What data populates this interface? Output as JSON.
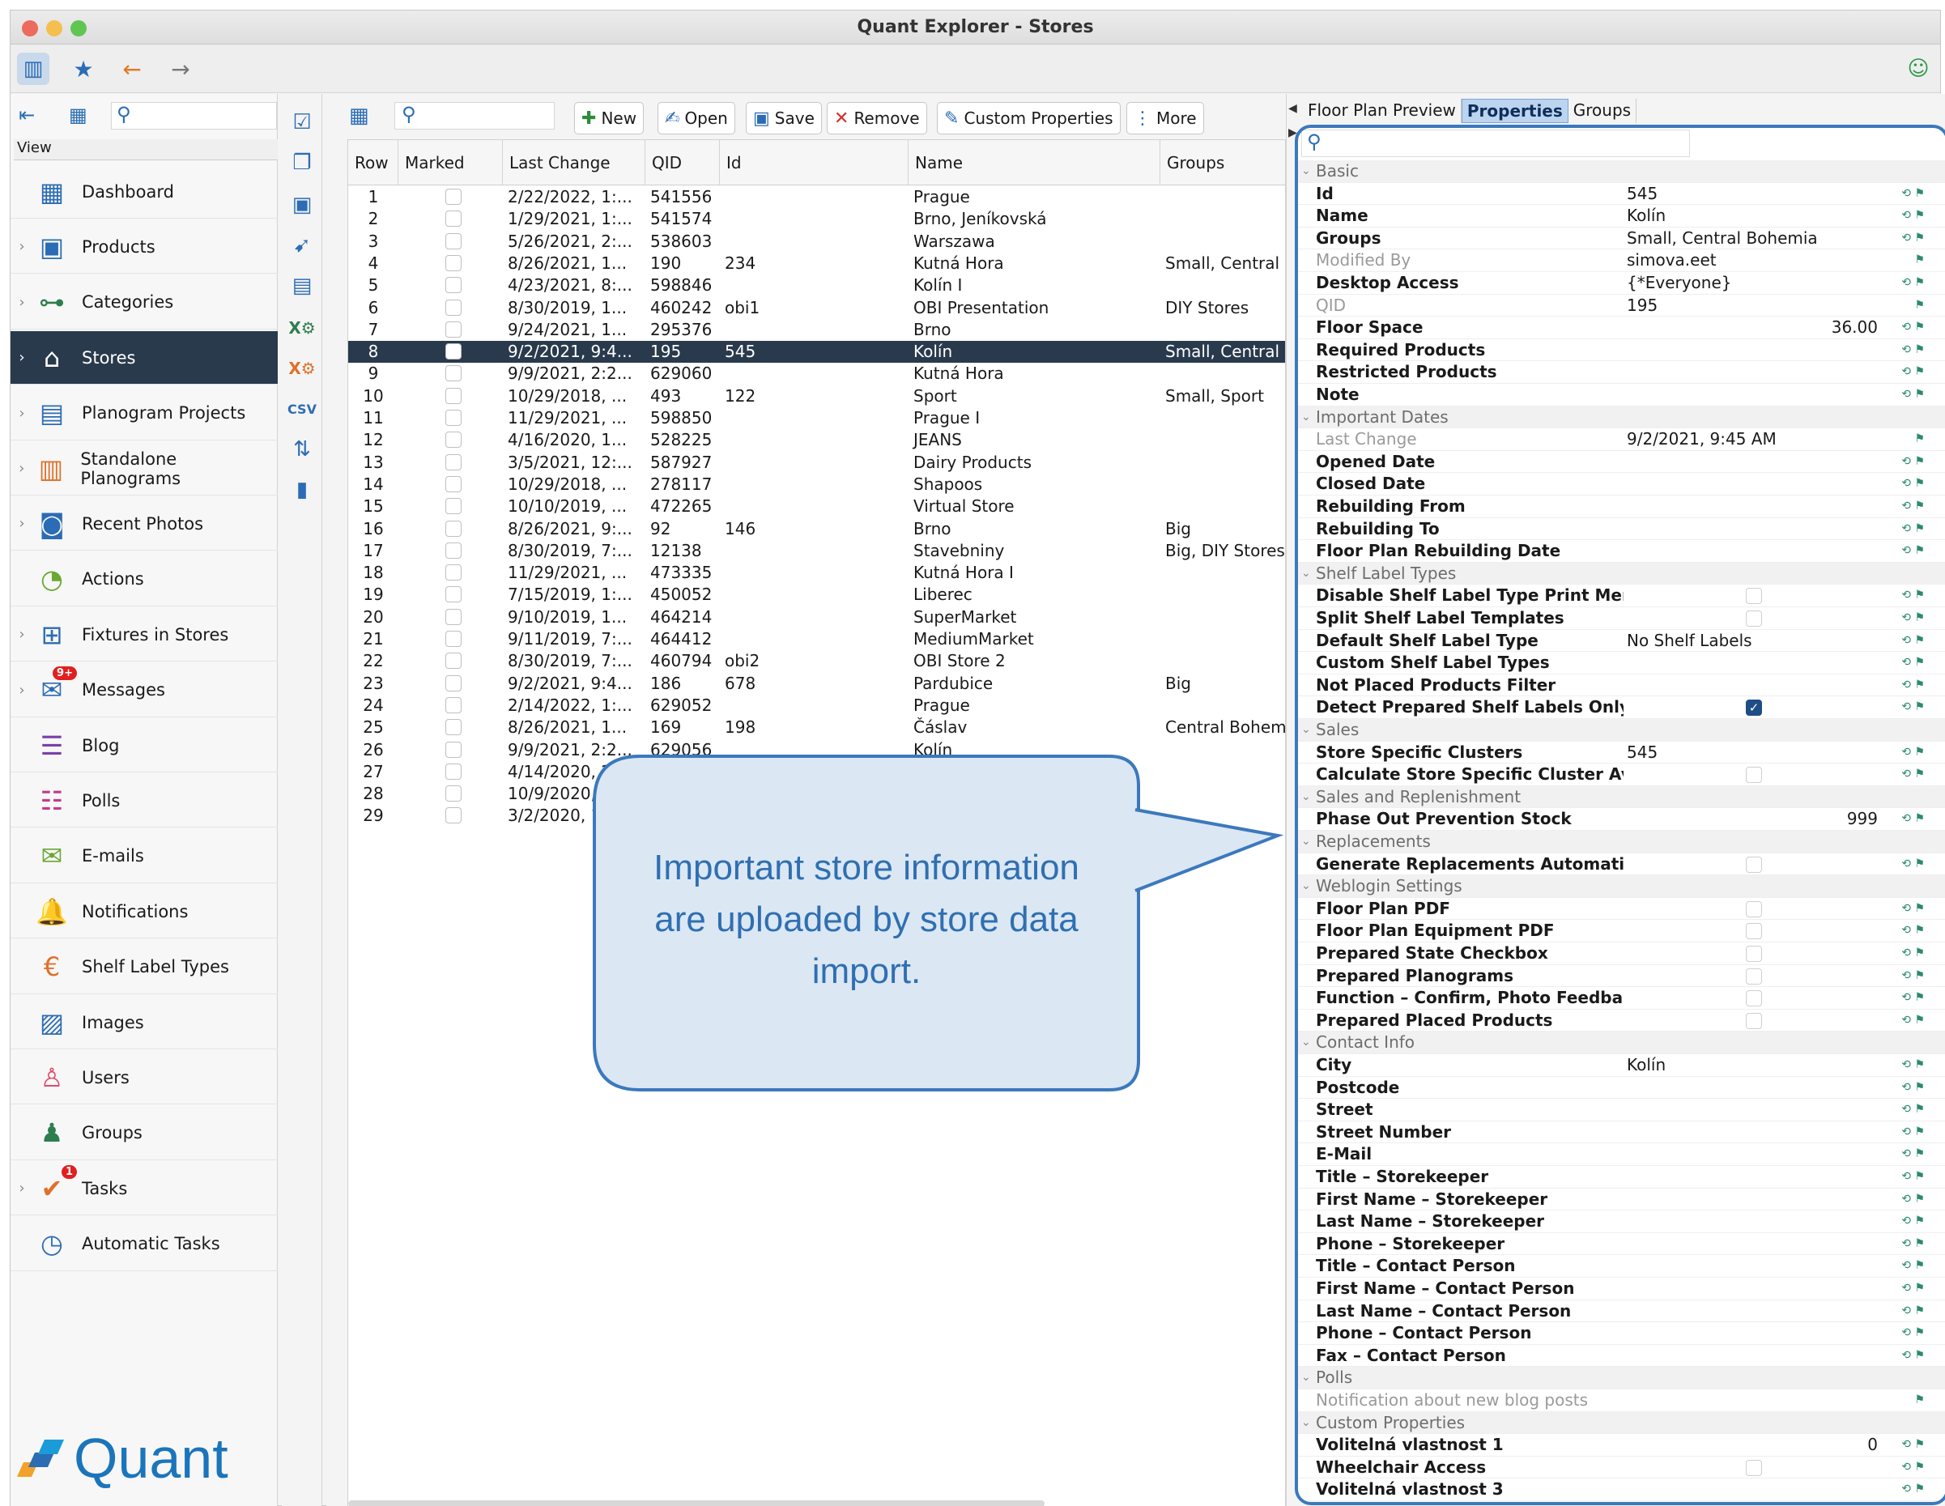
{
  "window": {
    "title": "Quant Explorer - Stores"
  },
  "nav_icons": {
    "sidebar_toggle": "sidebar-icon",
    "favorites": "star-icon",
    "back": "arrow-left-icon",
    "forward": "arrow-right-icon",
    "feedback": "smiley-icon"
  },
  "left_panel": {
    "view_label": "View",
    "items": [
      {
        "label": "Dashboard",
        "icon": "dashboard-icon",
        "glyph": "▦",
        "color": "#2b6cb4",
        "chevron": false
      },
      {
        "label": "Products",
        "icon": "products-icon",
        "glyph": "▣",
        "color": "#2b6cb4",
        "chevron": true
      },
      {
        "label": "Categories",
        "icon": "categories-icon",
        "glyph": "⊶",
        "color": "#2e7d4f",
        "chevron": true
      },
      {
        "label": "Stores",
        "icon": "store-icon",
        "glyph": "⌂",
        "color": "#e24a6a",
        "chevron": true,
        "selected": true
      },
      {
        "label": "Planogram Projects",
        "icon": "planogram-projects-icon",
        "glyph": "▤",
        "color": "#2b6cb4",
        "chevron": true
      },
      {
        "label": "Standalone Planograms",
        "icon": "standalone-planograms-icon",
        "glyph": "▥",
        "color": "#e0702a",
        "chevron": true
      },
      {
        "label": "Recent Photos",
        "icon": "camera-icon",
        "glyph": "◙",
        "color": "#2b6cb4",
        "chevron": true
      },
      {
        "label": "Actions",
        "icon": "actions-icon",
        "glyph": "◔",
        "color": "#6aa832",
        "chevron": false
      },
      {
        "label": "Fixtures in Stores",
        "icon": "fixtures-icon",
        "glyph": "⊞",
        "color": "#2b6cb4",
        "chevron": true
      },
      {
        "label": "Messages",
        "icon": "messages-icon",
        "glyph": "✉",
        "color": "#2b6cb4",
        "chevron": true,
        "badge": "9+"
      },
      {
        "label": "Blog",
        "icon": "blog-icon",
        "glyph": "☰",
        "color": "#7a3fa8",
        "chevron": false
      },
      {
        "label": "Polls",
        "icon": "polls-icon",
        "glyph": "☷",
        "color": "#c23a8a",
        "chevron": false
      },
      {
        "label": "E-mails",
        "icon": "email-icon",
        "glyph": "✉",
        "color": "#6aa832",
        "chevron": false
      },
      {
        "label": "Notifications",
        "icon": "notifications-icon",
        "glyph": "🔔",
        "color": "#2b6cb4",
        "chevron": false
      },
      {
        "label": "Shelf Label Types",
        "icon": "shelf-label-icon",
        "glyph": "€",
        "color": "#e0702a",
        "chevron": false
      },
      {
        "label": "Images",
        "icon": "images-icon",
        "glyph": "▨",
        "color": "#2b6cb4",
        "chevron": false
      },
      {
        "label": "Users",
        "icon": "users-icon",
        "glyph": "♙",
        "color": "#e24a6a",
        "chevron": false
      },
      {
        "label": "Groups",
        "icon": "groups-icon",
        "glyph": "♟",
        "color": "#2e7d4f",
        "chevron": false
      },
      {
        "label": "Tasks",
        "icon": "tasks-icon",
        "glyph": "✔",
        "color": "#e0702a",
        "chevron": true,
        "badge": "1"
      },
      {
        "label": "Automatic Tasks",
        "icon": "automatic-tasks-icon",
        "glyph": "◷",
        "color": "#2b6cb4",
        "chevron": false
      }
    ],
    "logo_text": "Quant"
  },
  "toolbar": {
    "new_label": "New",
    "open_label": "Open",
    "save_label": "Save",
    "remove_label": "Remove",
    "custom_label": "Custom Properties",
    "more_label": "More"
  },
  "table": {
    "columns": {
      "row": "Row",
      "marked": "Marked",
      "last_change": "Last Change",
      "qid": "QID",
      "id": "Id",
      "name": "Name",
      "groups": "Groups"
    },
    "rows": [
      {
        "row": "1",
        "last_change": "2/22/2022, 1:...",
        "qid": "541556",
        "id": "",
        "name": "Prague",
        "groups": ""
      },
      {
        "row": "2",
        "last_change": "1/29/2021, 1:...",
        "qid": "541574",
        "id": "",
        "name": "Brno, Jeníkovská",
        "groups": ""
      },
      {
        "row": "3",
        "last_change": "5/26/2021, 2:...",
        "qid": "538603",
        "id": "",
        "name": "Warszawa",
        "groups": ""
      },
      {
        "row": "4",
        "last_change": "8/26/2021, 1...",
        "qid": "190",
        "id": "234",
        "name": "Kutná Hora",
        "groups": "Small, Central"
      },
      {
        "row": "5",
        "last_change": "4/23/2021, 8:...",
        "qid": "598846",
        "id": "",
        "name": "Kolín I",
        "groups": ""
      },
      {
        "row": "6",
        "last_change": "8/30/2019, 1...",
        "qid": "460242",
        "id": "obi1",
        "name": "OBI Presentation",
        "groups": "DIY Stores"
      },
      {
        "row": "7",
        "last_change": "9/24/2021, 1...",
        "qid": "295376",
        "id": "",
        "name": "Brno",
        "groups": ""
      },
      {
        "row": "8",
        "last_change": "9/2/2021, 9:4...",
        "qid": "195",
        "id": "545",
        "name": "Kolín",
        "groups": "Small, Central",
        "selected": true
      },
      {
        "row": "9",
        "last_change": "9/9/2021, 2:2...",
        "qid": "629060",
        "id": "",
        "name": "Kutná Hora",
        "groups": ""
      },
      {
        "row": "10",
        "last_change": "10/29/2018, ...",
        "qid": "493",
        "id": "122",
        "name": "Sport",
        "groups": "Small, Sport"
      },
      {
        "row": "11",
        "last_change": "11/29/2021, ...",
        "qid": "598850",
        "id": "",
        "name": "Prague I",
        "groups": ""
      },
      {
        "row": "12",
        "last_change": "4/16/2020, 1...",
        "qid": "528225",
        "id": "",
        "name": "JEANS",
        "groups": ""
      },
      {
        "row": "13",
        "last_change": "3/5/2021, 12:...",
        "qid": "587927",
        "id": "",
        "name": "Dairy Products",
        "groups": ""
      },
      {
        "row": "14",
        "last_change": "10/29/2018, ...",
        "qid": "278117",
        "id": "",
        "name": "Shapoos",
        "groups": ""
      },
      {
        "row": "15",
        "last_change": "10/10/2019, ...",
        "qid": "472265",
        "id": "",
        "name": "Virtual Store",
        "groups": ""
      },
      {
        "row": "16",
        "last_change": "8/26/2021, 9:...",
        "qid": "92",
        "id": "146",
        "name": "Brno",
        "groups": "Big"
      },
      {
        "row": "17",
        "last_change": "8/30/2019, 7:...",
        "qid": "12138",
        "id": "",
        "name": "Stavebniny",
        "groups": "Big, DIY Stores"
      },
      {
        "row": "18",
        "last_change": "11/29/2021, ...",
        "qid": "473335",
        "id": "",
        "name": "Kutná Hora I",
        "groups": ""
      },
      {
        "row": "19",
        "last_change": "7/15/2019, 1:...",
        "qid": "450052",
        "id": "",
        "name": "Liberec",
        "groups": ""
      },
      {
        "row": "20",
        "last_change": "9/10/2019, 1...",
        "qid": "464214",
        "id": "",
        "name": "SuperMarket",
        "groups": ""
      },
      {
        "row": "21",
        "last_change": "9/11/2019, 7:...",
        "qid": "464412",
        "id": "",
        "name": "MediumMarket",
        "groups": ""
      },
      {
        "row": "22",
        "last_change": "8/30/2019, 7:...",
        "qid": "460794",
        "id": "obi2",
        "name": "OBI Store 2",
        "groups": ""
      },
      {
        "row": "23",
        "last_change": "9/2/2021, 9:4...",
        "qid": "186",
        "id": "678",
        "name": "Pardubice",
        "groups": "Big"
      },
      {
        "row": "24",
        "last_change": "2/14/2022, 1:...",
        "qid": "629052",
        "id": "",
        "name": "Prague",
        "groups": ""
      },
      {
        "row": "25",
        "last_change": "8/26/2021, 1...",
        "qid": "169",
        "id": "198",
        "name": "Čáslav",
        "groups": "Central Bohem"
      },
      {
        "row": "26",
        "last_change": "9/9/2021, 2:2...",
        "qid": "629056",
        "id": "",
        "name": "Kolín",
        "groups": ""
      },
      {
        "row": "27",
        "last_change": "4/14/2020, 2:",
        "qid": "",
        "id": "",
        "name": "",
        "groups": ""
      },
      {
        "row": "28",
        "last_change": "10/9/2020,",
        "qid": "",
        "id": "",
        "name": "",
        "groups": ""
      },
      {
        "row": "29",
        "last_change": "3/2/2020, 1",
        "qid": "",
        "id": "",
        "name": "",
        "groups": ""
      }
    ]
  },
  "callout": {
    "line1": "Important store information",
    "line2": "are uploaded by store data",
    "line3": "import."
  },
  "right_panel": {
    "tabs": [
      "Floor Plan Preview",
      "Properties",
      "Groups"
    ],
    "properties": [
      {
        "type": "section",
        "name": "Basic"
      },
      {
        "name": "Id",
        "value": "545"
      },
      {
        "name": "Name",
        "value": "Kolín"
      },
      {
        "name": "Groups",
        "value": "Small, Central Bohemia"
      },
      {
        "name": "Modified By",
        "value": "simova.eet",
        "readonly": true
      },
      {
        "name": "Desktop Access",
        "value": "{*Everyone}"
      },
      {
        "name": "QID",
        "value": "195",
        "readonly": true
      },
      {
        "name": "Floor Space",
        "value": "36.00",
        "align": "right"
      },
      {
        "name": "Required Products",
        "value": ""
      },
      {
        "name": "Restricted Products",
        "value": ""
      },
      {
        "name": "Note",
        "value": ""
      },
      {
        "type": "section",
        "name": "Important Dates"
      },
      {
        "name": "Last Change",
        "value": "9/2/2021, 9:45 AM",
        "readonly": true
      },
      {
        "name": "Opened Date",
        "value": ""
      },
      {
        "name": "Closed Date",
        "value": ""
      },
      {
        "name": "Rebuilding From",
        "value": ""
      },
      {
        "name": "Rebuilding To",
        "value": ""
      },
      {
        "name": "Floor Plan Rebuilding Date",
        "value": ""
      },
      {
        "type": "section",
        "name": "Shelf Label Types"
      },
      {
        "name": "Disable Shelf Label Type Print Mer...",
        "checkbox": "off"
      },
      {
        "name": "Split Shelf Label Templates",
        "checkbox": "off"
      },
      {
        "name": "Default Shelf Label Type",
        "value": "No Shelf Labels"
      },
      {
        "name": "Custom Shelf Label Types",
        "value": ""
      },
      {
        "name": "Not Placed Products Filter",
        "value": ""
      },
      {
        "name": "Detect Prepared Shelf Labels Only ...",
        "checkbox": "on"
      },
      {
        "type": "section",
        "name": "Sales"
      },
      {
        "name": "Store Specific Clusters",
        "value": "545"
      },
      {
        "name": "Calculate Store Specific Cluster Av...",
        "checkbox": "off"
      },
      {
        "type": "section",
        "name": "Sales and Replenishment"
      },
      {
        "name": "Phase Out Prevention Stock",
        "value": "999",
        "align": "right"
      },
      {
        "type": "section",
        "name": "Replacements"
      },
      {
        "name": "Generate Replacements Automatic...",
        "checkbox": "off"
      },
      {
        "type": "section",
        "name": "Weblogin Settings"
      },
      {
        "name": "Floor Plan PDF",
        "checkbox": "off"
      },
      {
        "name": "Floor Plan Equipment PDF",
        "checkbox": "off"
      },
      {
        "name": "Prepared State Checkbox",
        "checkbox": "off"
      },
      {
        "name": "Prepared Planograms",
        "checkbox": "off"
      },
      {
        "name": "Function – Confirm, Photo Feedba...",
        "checkbox": "off"
      },
      {
        "name": "Prepared Placed Products",
        "checkbox": "off"
      },
      {
        "type": "section",
        "name": "Contact Info"
      },
      {
        "name": "City",
        "value": "Kolín"
      },
      {
        "name": "Postcode",
        "value": ""
      },
      {
        "name": "Street",
        "value": ""
      },
      {
        "name": "Street Number",
        "value": ""
      },
      {
        "name": "E-Mail",
        "value": ""
      },
      {
        "name": "Title – Storekeeper",
        "value": ""
      },
      {
        "name": "First Name – Storekeeper",
        "value": ""
      },
      {
        "name": "Last Name – Storekeeper",
        "value": ""
      },
      {
        "name": "Phone – Storekeeper",
        "value": ""
      },
      {
        "name": "Title – Contact Person",
        "value": ""
      },
      {
        "name": "First Name – Contact Person",
        "value": ""
      },
      {
        "name": "Last Name – Contact Person",
        "value": ""
      },
      {
        "name": "Phone – Contact Person",
        "value": ""
      },
      {
        "name": "Fax – Contact Person",
        "value": ""
      },
      {
        "type": "section",
        "name": "Polls"
      },
      {
        "name": "Notification about new blog posts",
        "value": "",
        "readonly": true
      },
      {
        "type": "section",
        "name": "Custom Properties"
      },
      {
        "name": "Volitelná vlastnost 1",
        "value": "0",
        "align": "right"
      },
      {
        "name": "Wheelchair Access",
        "checkbox": "off"
      },
      {
        "name": "Volitelná vlastnost 3",
        "value": ""
      }
    ]
  },
  "colors": {
    "accent": "#2b6cb4",
    "selection": "#2a3a4d",
    "callout_border": "#3b79bd",
    "callout_text": "#2f6fb2"
  }
}
